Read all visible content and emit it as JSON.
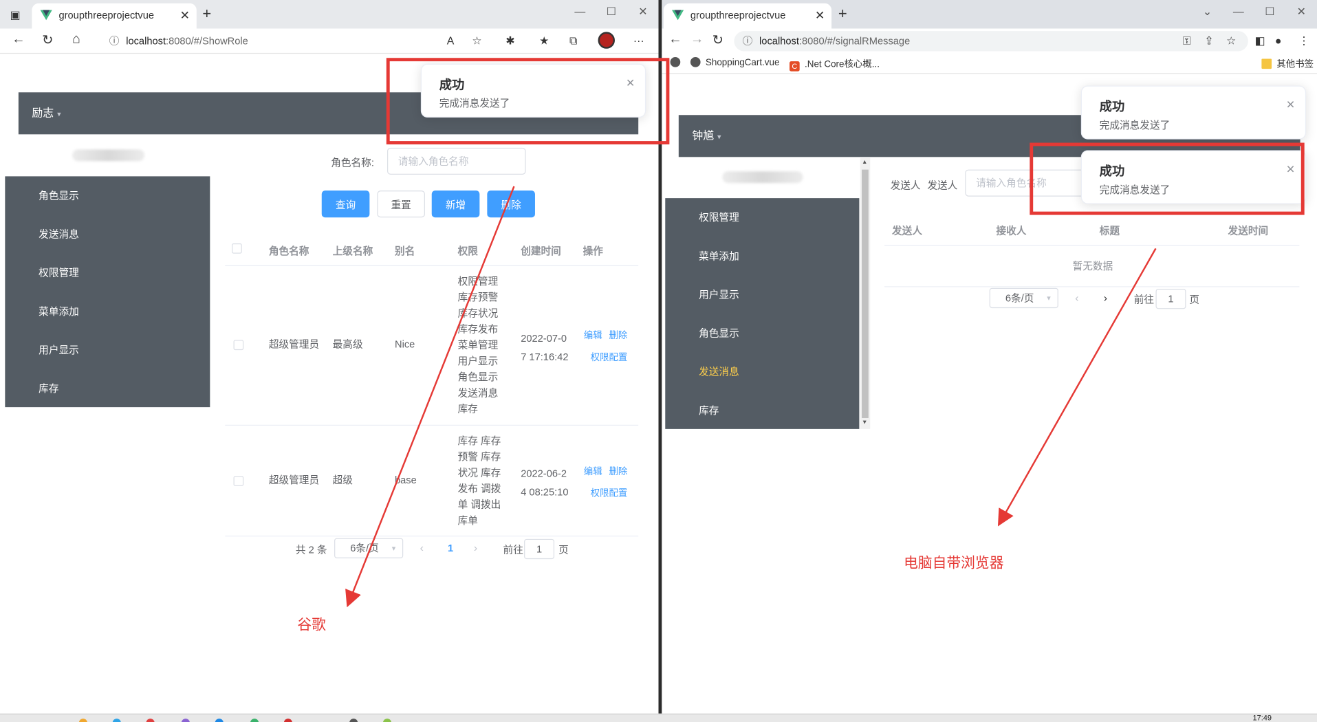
{
  "left_browser": {
    "tab_title": "groupthreeprojectvue",
    "url_host": "localhost",
    "url_rest": ":8080/#/ShowRole",
    "app": {
      "top_menu": "励志",
      "sidebar": [
        "角色显示",
        "发送消息",
        "权限管理",
        "菜单添加",
        "用户显示",
        "库存"
      ],
      "search_label": "角色名称:",
      "search_placeholder": "请输入角色名称",
      "buttons": {
        "query": "查询",
        "reset": "重置",
        "add": "新增",
        "delete": "删除"
      },
      "table": {
        "headers": [
          "角色名称",
          "上级名称",
          "别名",
          "权限",
          "创建时间",
          "操作"
        ],
        "rows": [
          {
            "name": "超级管理员",
            "parent": "最高级",
            "alias": "Nice",
            "perms": [
              "权限管理",
              "库存预警",
              "库存状况",
              "库存发布",
              "菜单管理",
              "用户显示",
              "角色显示",
              "发送消息",
              "库存"
            ],
            "created": [
              "2022-07-0",
              "7 17:16:42"
            ],
            "edit": "编辑",
            "del": "删除",
            "config": "权限配置"
          },
          {
            "name": "超级管理员",
            "parent": "超级",
            "alias": "base",
            "perms": [
              "库存 库存",
              "预警 库存",
              "状况 库存",
              "发布 调拨",
              "单 调拨出",
              "库单"
            ],
            "created": [
              "2022-06-2",
              "4 08:25:10"
            ],
            "edit": "编辑",
            "del": "删除",
            "config": "权限配置"
          }
        ]
      },
      "pagination": {
        "total": "共 2 条",
        "page_size": "6条/页",
        "current": "1",
        "goto": "前往",
        "goto_value": "1",
        "page_unit": "页"
      }
    },
    "notification": {
      "title": "成功",
      "body": "完成消息发送了"
    },
    "annotation": "谷歌"
  },
  "right_browser": {
    "tab_title": "groupthreeprojectvue",
    "url_host": "localhost",
    "url_rest": ":8080/#/signalRMessage",
    "bookmarks": [
      "ShoppingCart.vue",
      ".Net Core核心概...",
      "其他书签"
    ],
    "app": {
      "top_menu": "钟馗",
      "sidebar": [
        "权限管理",
        "菜单添加",
        "用户显示",
        "角色显示",
        "发送消息",
        "库存"
      ],
      "active_item": "发送消息",
      "sender_label_1": "发送人",
      "sender_label_2": "发送人",
      "search_placeholder": "请输入角色名称",
      "table_headers": [
        "发送人",
        "接收人",
        "标题",
        "发送时间"
      ],
      "empty_text": "暂无数据",
      "pagination": {
        "page_size": "6条/页",
        "goto": "前往",
        "goto_value": "1",
        "page_unit": "页"
      }
    },
    "notifications": [
      {
        "title": "成功",
        "body": "完成消息发送了"
      },
      {
        "title": "成功",
        "body": "完成消息发送了"
      }
    ],
    "annotation": "电脑自带浏览器"
  },
  "taskbar": {
    "clock": "17:49"
  },
  "colors": {
    "menu_bg": "#545c64",
    "active": "#ffd04b",
    "primary": "#409eff",
    "annotation": "#e53935"
  }
}
